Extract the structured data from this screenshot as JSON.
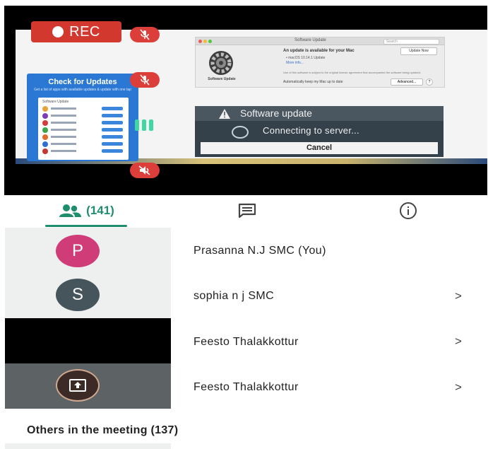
{
  "video": {
    "rec_label": "REC",
    "check_for_updates": {
      "title": "Check for Updates",
      "subtitle": "Get a list of apps with available updates & update with one tap",
      "list_header": "Software Update"
    },
    "mac_window": {
      "title": "Software Update",
      "search_placeholder": "Search",
      "icon_label": "Software Update",
      "heading": "An update is available for your Mac",
      "item": "• macOS 10.14.1 Update",
      "more_info": "More info...",
      "update_now": "Update Now",
      "footer": "Use of this software is subject to the original license agreement that accompanied the software being updated.",
      "auto_label": "Automatically keep my Mac up to date",
      "advanced": "Advanced...",
      "help": "?"
    },
    "dialog": {
      "title": "Software update",
      "message": "Connecting to server...",
      "cancel": "Cancel"
    }
  },
  "tabs": {
    "people_count": "(141)",
    "people_icon": "people-icon",
    "chat_icon": "chat-icon",
    "info_icon": "info-icon",
    "accent": "#1e8e6e"
  },
  "participants": [
    {
      "initial": "P",
      "name": "Prasanna N.J SMC (You)",
      "muted": true,
      "avatar_color": "#cf3c78"
    },
    {
      "initial": "S",
      "name": "sophia n j SMC",
      "muted": true,
      "chevron": ">",
      "avatar_color": "#46545c"
    },
    {
      "name": "Feesto Thalakkottur",
      "speaking": true,
      "chevron": ">"
    },
    {
      "name": "Feesto Thalakkottur",
      "presenting": true,
      "muted": true,
      "chevron": ">"
    }
  ],
  "others": {
    "label": "Others in the meeting (137)"
  },
  "colors": {
    "mute_red": "#dc3f3a",
    "speaking_green": "#3ed8a2",
    "rec_red": "#d3382f"
  }
}
